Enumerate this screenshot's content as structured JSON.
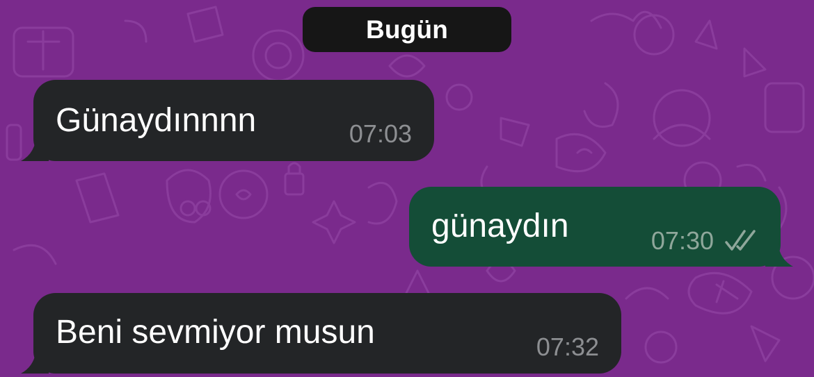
{
  "chat": {
    "date_label": "Bugün",
    "messages": [
      {
        "direction": "incoming",
        "text": "Günaydınnnn",
        "time": "07:03"
      },
      {
        "direction": "outgoing",
        "text": "günaydın",
        "time": "07:30",
        "status_icon": "double-check-icon"
      },
      {
        "direction": "incoming",
        "text": "Beni sevmiyor musun",
        "time": "07:32"
      }
    ]
  },
  "colors": {
    "wallpaper": "#7a2a8c",
    "wallpaper_doodle": "#8c3f9e",
    "incoming_bubble": "#232527",
    "outgoing_bubble": "#144d37",
    "date_pill": "#161616",
    "timestamp": "#8d8f92"
  }
}
